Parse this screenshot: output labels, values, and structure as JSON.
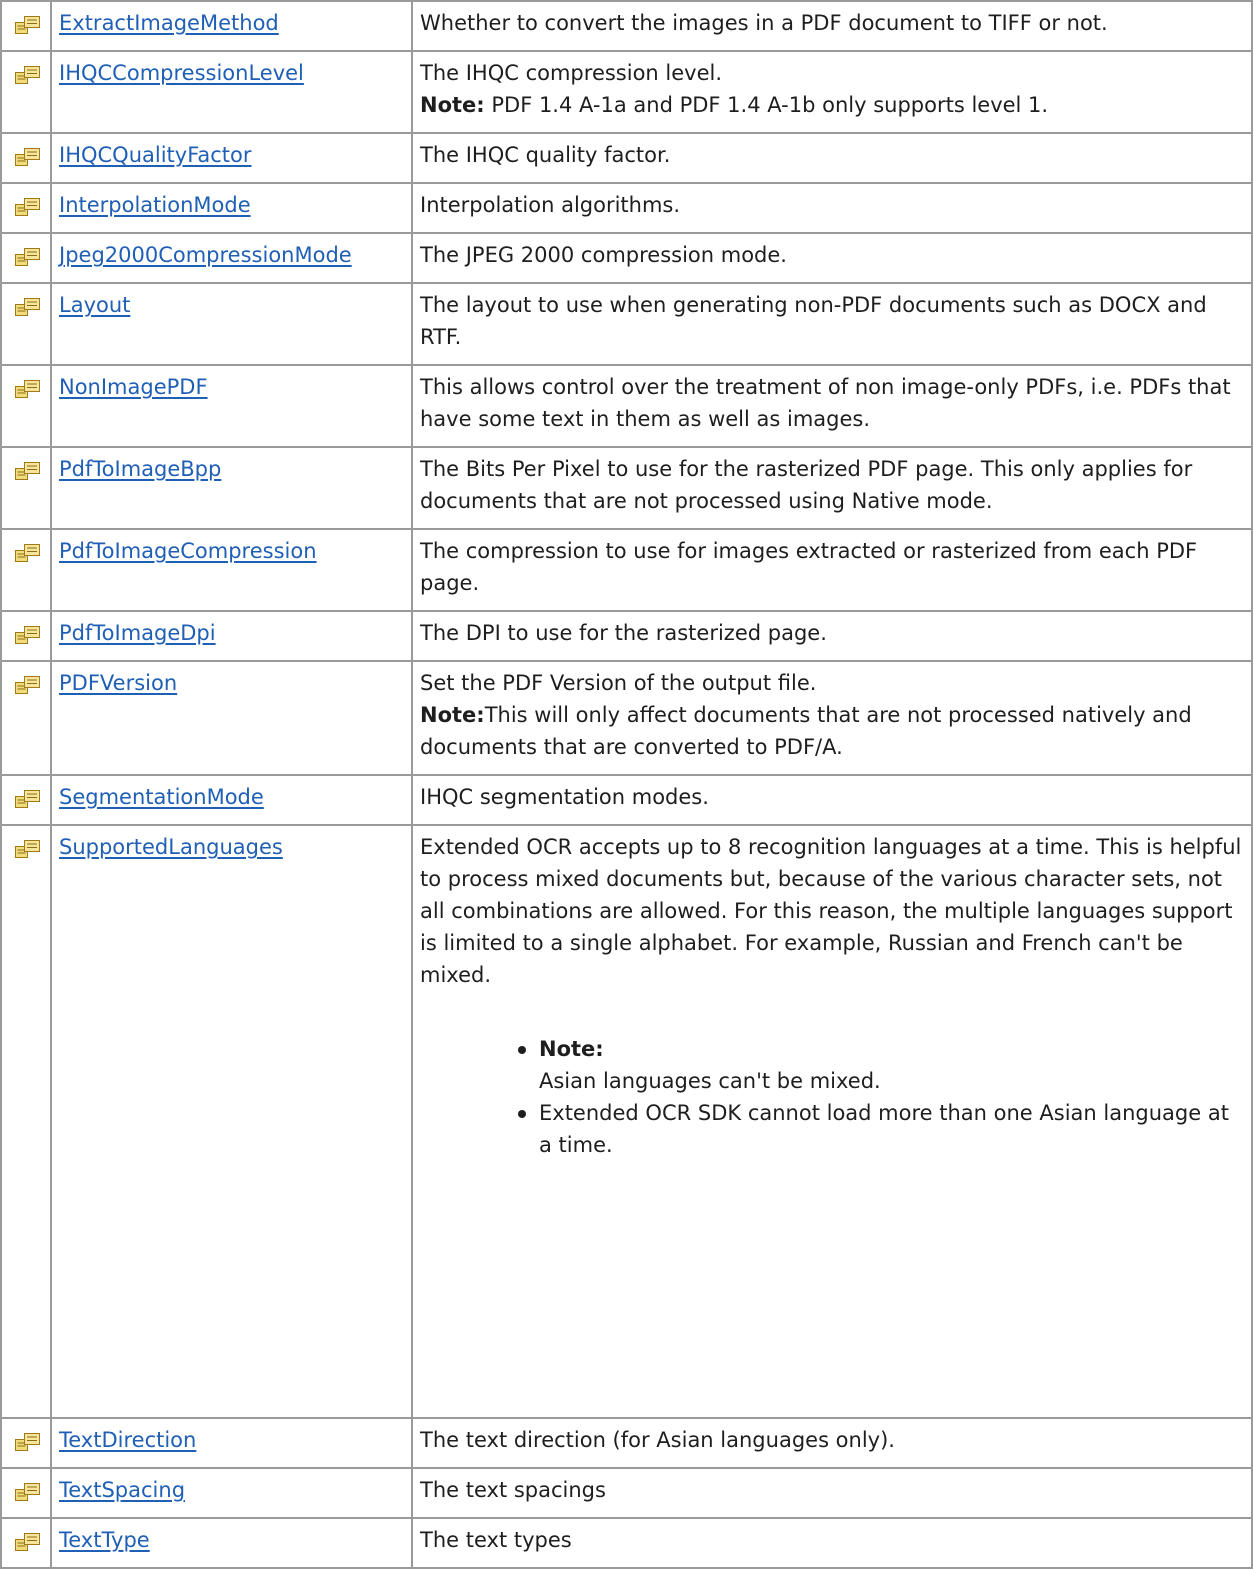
{
  "colors": {
    "link": "#1f5fb5",
    "border": "#9a9a9a",
    "text": "#1e1e1e"
  },
  "icon": "public-property-icon",
  "rows": [
    {
      "name": "ExtractImageMethod",
      "desc": "Whether to convert the images in a PDF document to TIFF or not."
    },
    {
      "name": "IHQCCompressionLevel",
      "desc": "The IHQC compression level.",
      "note_label": "Note:",
      "note_text": " PDF 1.4 A-1a and PDF 1.4 A-1b only supports level 1."
    },
    {
      "name": "IHQCQualityFactor",
      "desc": "The IHQC quality factor."
    },
    {
      "name": "InterpolationMode",
      "desc": "Interpolation algorithms."
    },
    {
      "name": "Jpeg2000CompressionMode",
      "desc": "The JPEG 2000 compression mode."
    },
    {
      "name": "Layout",
      "desc": "The layout to use when generating non-PDF documents such as DOCX and RTF."
    },
    {
      "name": "NonImagePDF",
      "desc": "This allows control over the treatment of non image-only PDFs, i.e. PDFs that have some text in them as well as images."
    },
    {
      "name": "PdfToImageBpp",
      "desc": "The Bits Per Pixel to use for the rasterized PDF page. This only applies for documents that are not processed using Native mode."
    },
    {
      "name": "PdfToImageCompression",
      "desc": "The compression to use for images extracted or rasterized from each PDF page."
    },
    {
      "name": "PdfToImageDpi",
      "desc": "The DPI to use for the rasterized page."
    },
    {
      "name": "PDFVersion",
      "desc": "Set the PDF Version of the output file.",
      "note_label": "Note:",
      "note_text": "This will only affect documents that are not processed natively and documents that are converted to PDF/A."
    },
    {
      "name": "SegmentationMode",
      "desc": "IHQC segmentation modes."
    },
    {
      "name": "SupportedLanguages",
      "desc": "Extended OCR accepts up to 8 recognition languages at a time. This is helpful to process mixed documents but, because of the various character sets, not all combinations are allowed. For this reason, the multiple languages support is limited to a single alphabet. For example, Russian and French can't be mixed.",
      "bullets": [
        {
          "label": "Note:",
          "text": "Asian languages can't be mixed."
        },
        {
          "text": "Extended OCR SDK cannot load more than one Asian language at a time."
        }
      ]
    },
    {
      "name": "TextDirection",
      "desc": "The text direction (for Asian languages only)."
    },
    {
      "name": "TextSpacing",
      "desc": "The text spacings"
    },
    {
      "name": "TextType",
      "desc": "The text types"
    }
  ]
}
